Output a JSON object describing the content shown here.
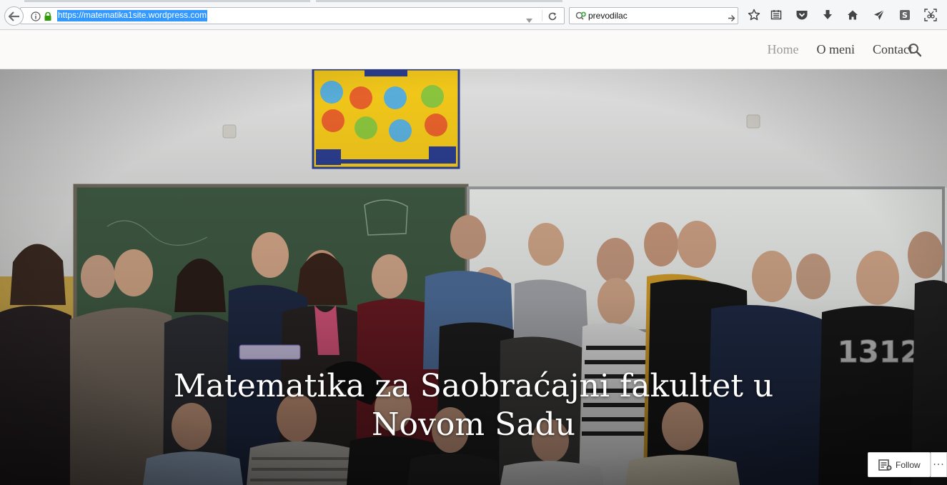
{
  "browser": {
    "url": "https://matematika1site.wordpress.com",
    "search_query": "prevodilac",
    "toolbar_icons": [
      "bookmark-star-icon",
      "reader-view-icon",
      "pocket-icon",
      "downloads-icon",
      "home-icon",
      "send-tab-icon",
      "skype-icon",
      "screenshot-icon"
    ]
  },
  "site": {
    "nav": {
      "home": "Home",
      "about": "O meni",
      "contact": "Contact"
    },
    "hero_title_line1": "Matematika za Saobraćajni fakultet u",
    "hero_title_line2": "Novom Sadu"
  },
  "follow": {
    "label": "Follow",
    "more": "···"
  },
  "colors": {
    "url_highlight": "#3399ff",
    "nav_active": "#9a9a9a",
    "nav_text": "#404040"
  }
}
